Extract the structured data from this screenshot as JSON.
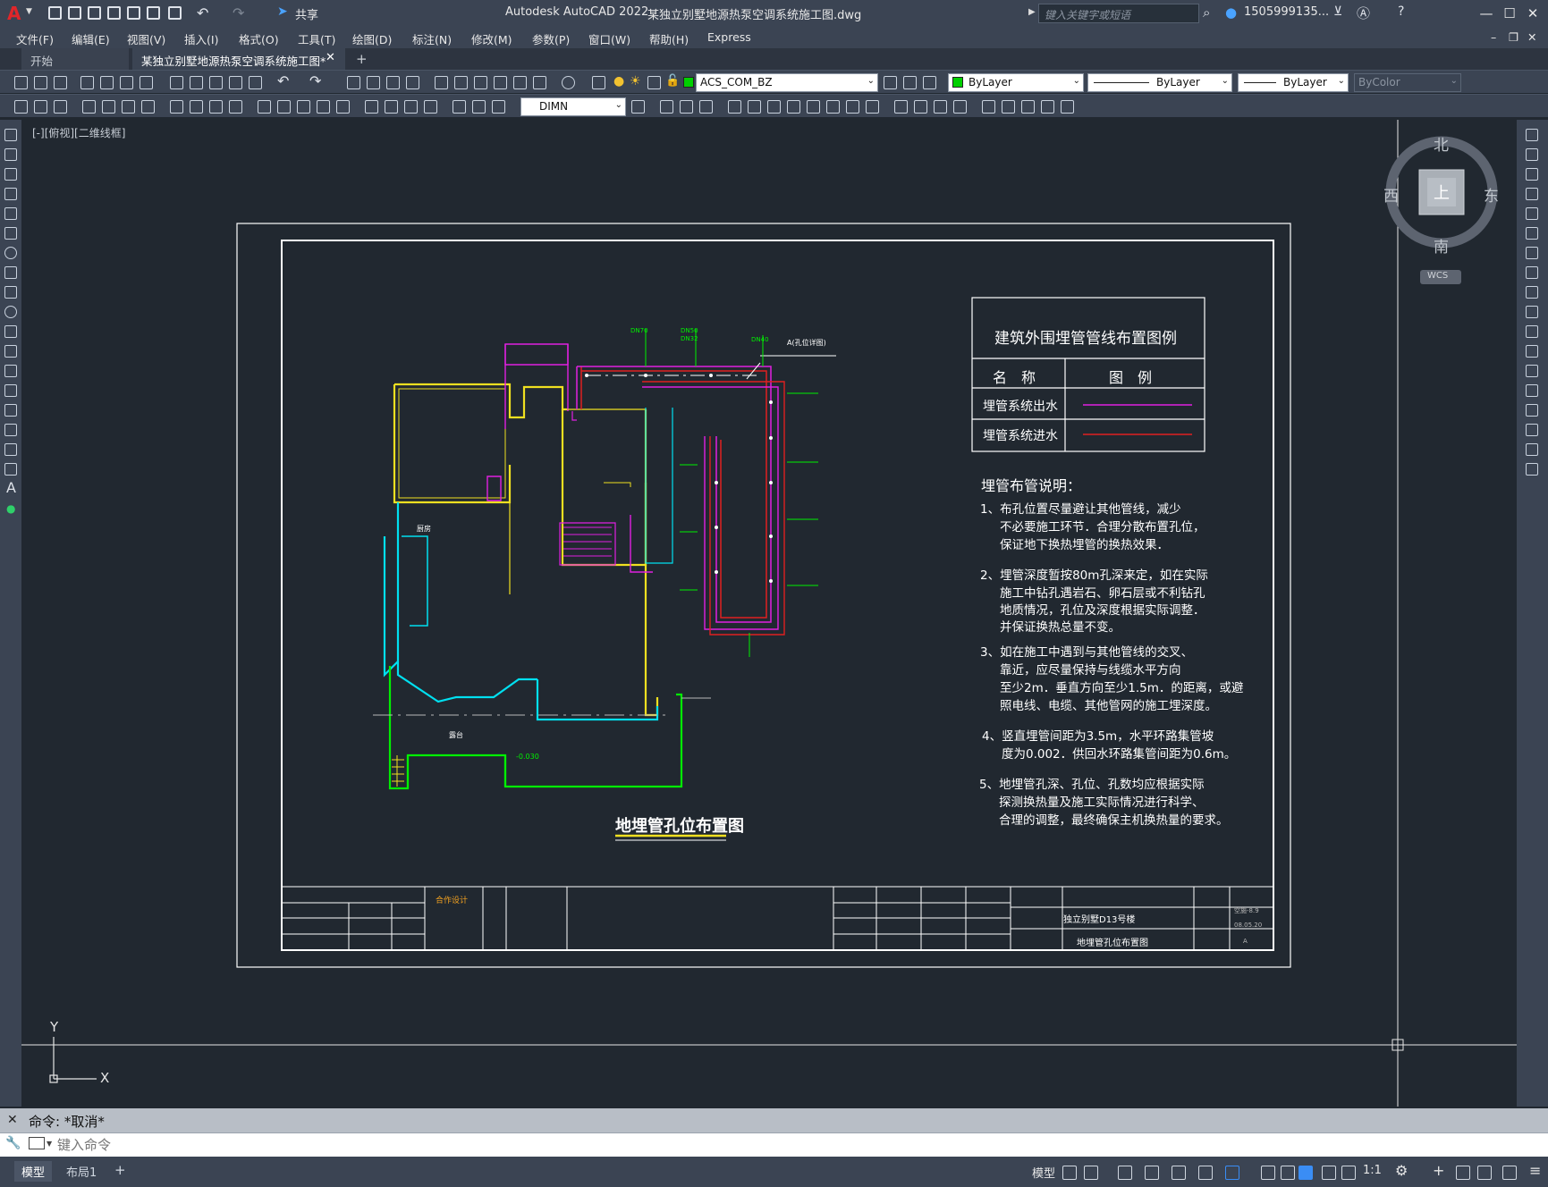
{
  "app": {
    "title": "Autodesk AutoCAD 2022",
    "file": "某独立别墅地源热泵空调系统施工图.dwg",
    "share_label": "共享",
    "search_placeholder": "键入关键字或短语",
    "user": "1505999135...",
    "logo": "A"
  },
  "menu": [
    "文件(F)",
    "编辑(E)",
    "视图(V)",
    "插入(I)",
    "格式(O)",
    "工具(T)",
    "绘图(D)",
    "标注(N)",
    "修改(M)",
    "参数(P)",
    "窗口(W)",
    "帮助(H)",
    "Express"
  ],
  "tabs": {
    "start": "开始",
    "active": "某独立别墅地源热泵空调系统施工图*",
    "add": "+"
  },
  "toolbar": {
    "layer": "ACS_COM_BZ",
    "color": "ByLayer",
    "linetype": "ByLayer",
    "lineweight": "ByLayer",
    "plotstyle": "ByColor",
    "dimstyle": "DIMN"
  },
  "viewport": {
    "label": "[-][俯视][二维线框]",
    "viewcube": {
      "north": "北",
      "south": "南",
      "east": "东",
      "west": "西",
      "top": "上",
      "wcs": "WCS"
    },
    "ucs": {
      "x": "X",
      "y": "Y"
    }
  },
  "legend": {
    "title": "建筑外围埋管管线布置图例",
    "col_name": "名　称",
    "col_legend": "图　例",
    "rows": [
      {
        "name": "埋管系统出水",
        "color": "#e020e0"
      },
      {
        "name": "埋管系统进水",
        "color": "#e02020"
      }
    ]
  },
  "notes": {
    "title": "埋管布管说明：",
    "items": [
      [
        "1、布孔位置尽量避让其他管线，减少",
        "不必要施工环节．合理分散布置孔位，",
        "保证地下换热埋管的换热效果．"
      ],
      [
        "2、埋管深度暂按80m孔深来定，如在实际",
        "施工中钻孔遇岩石、卵石层或不利钻孔",
        "地质情况，孔位及深度根据实际调整．",
        "并保证换热总量不变。"
      ],
      [
        "3、如在施工中遇到与其他管线的交叉、",
        "靠近，应尽量保持与线缆水平方向",
        "至少2m．垂直方向至少1.5m．的距离，或避",
        "照电线、电缆、其他管网的施工埋深度。"
      ],
      [
        "4、竖直埋管间距为3.5m，水平环路集管坡",
        "度为0.002．供回水环路集管间距为0.6m。"
      ],
      [
        "5、地埋管孔深、孔位、孔数均应根据实际",
        "探测换热量及施工实际情况进行科学、",
        "合理的调整，最终确保主机换热量的要求。"
      ]
    ]
  },
  "plan": {
    "title": "地埋管孔位布置图",
    "pipe_labels": [
      "DN70",
      "DN50",
      "DN32",
      "DN40"
    ],
    "point_a": "A(孔位详图)",
    "level": "-0.030",
    "room_kitchen": "厨房",
    "room_terrace": "露台"
  },
  "titleblock": {
    "cooperate": "合作设计",
    "project": "独立别墅D13号楼",
    "drawing": "地埋管孔位布置图",
    "number": "空施-8.9",
    "date": "08.05.20",
    "version": "A"
  },
  "command": {
    "history": "命令: *取消*",
    "placeholder": "键入命令"
  },
  "status": {
    "model_tab": "模型",
    "layout_tab": "布局1",
    "model_btn": "模型",
    "scale": "1:1"
  }
}
